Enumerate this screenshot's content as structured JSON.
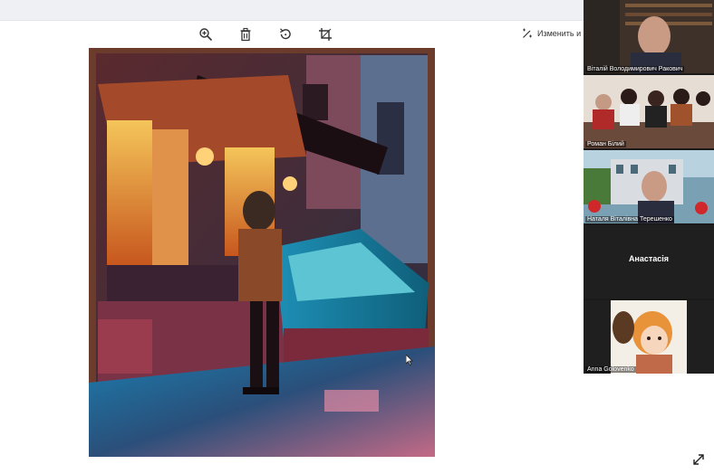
{
  "toolbar": {
    "tools": [
      {
        "icon": "zoom-in-icon"
      },
      {
        "icon": "trash-icon"
      },
      {
        "icon": "rotate-icon"
      },
      {
        "icon": "crop-icon"
      }
    ],
    "edit_label": "Изменить и со"
  },
  "participants": [
    {
      "name": "Віталій Володимирович Ракович"
    },
    {
      "name": "Роман Білий"
    },
    {
      "name": "Наталя Віталівна Терешенко"
    },
    {
      "name": "Анастасія"
    },
    {
      "name": "Anna Golovenko"
    }
  ],
  "colors": {
    "participant_panel": "#1a1a1a",
    "topbar": "#eef0f4",
    "page_background": "#ffffff"
  }
}
